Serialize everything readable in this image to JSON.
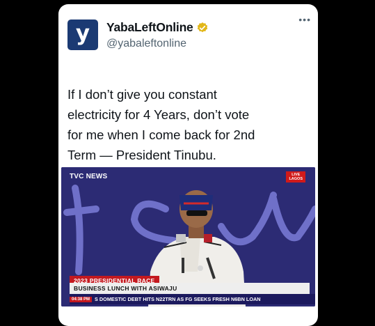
{
  "account": {
    "display_name": "YabaLeftOnline",
    "handle": "@yabaleftonline",
    "avatar_letter": "y",
    "avatar_color": "#1b3a73",
    "verified": true,
    "verified_icon": "gold-verified-badge-icon",
    "more_icon": "more-options-icon"
  },
  "tweet": {
    "text": "If I don’t give you constant\nelectricity for 4 Years, don’t vote\nfor me when I come back for 2nd\nTerm — President Tinubu."
  },
  "media": {
    "channel_logo": "TVC NEWS",
    "live_badge": "LIVE\nLAGOS",
    "lower_third_title": "2023 PRESIDENTIAL RACE",
    "lower_third_subtitle": "BUSINESS LUNCH WITH ASIWAJU",
    "ticker_time": "04:38 PM",
    "ticker_text": "S DOMESTIC DEBT HITS N22TRN AS FG SEEKS FRESH N6BN LOAN"
  },
  "colors": {
    "card_bg": "#ffffff",
    "page_bg": "#000000",
    "text_primary": "#0f1419",
    "text_secondary": "#536471",
    "tvc_backdrop": "#2c2b74",
    "ticker_red": "#c4191f"
  }
}
